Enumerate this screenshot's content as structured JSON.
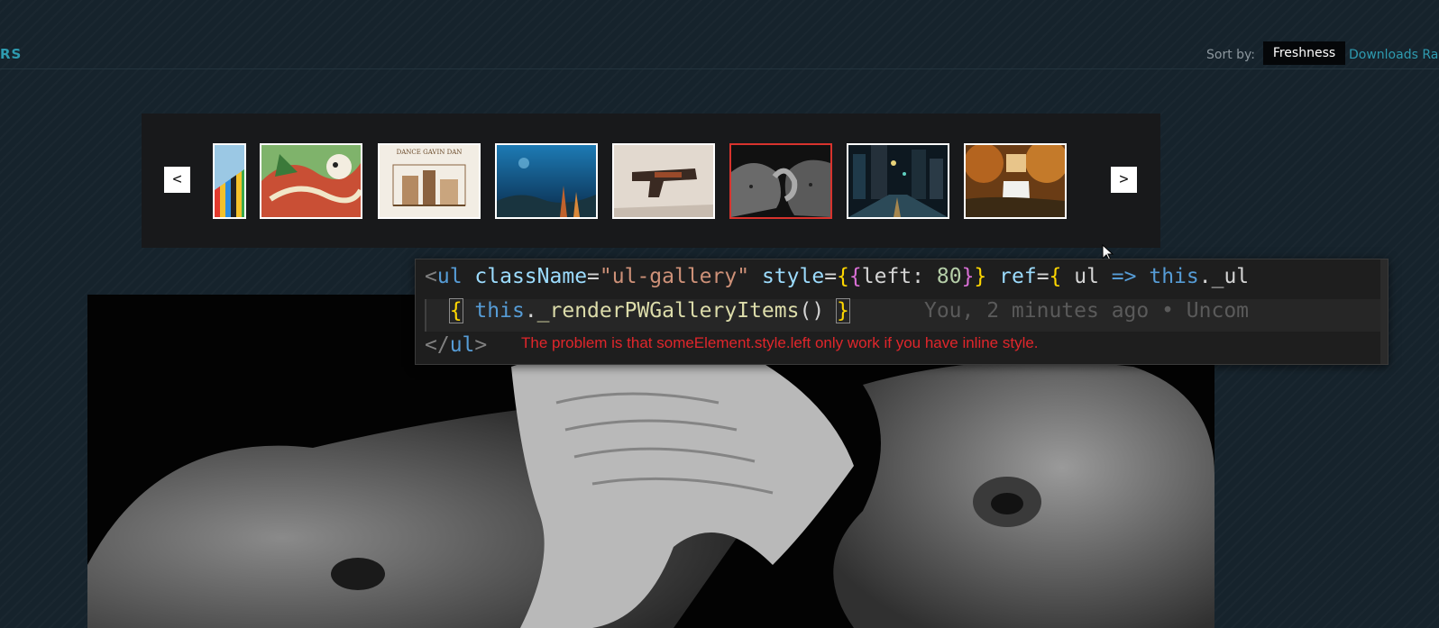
{
  "header": {
    "brand_fragment": "RS",
    "sort_label": "Sort by:",
    "sort_active": "Freshness",
    "sort_other": "Downloads Ra"
  },
  "gallery": {
    "prev_label": "<",
    "next_label": ">",
    "thumbnails": [
      {
        "name": "colorful-bars"
      },
      {
        "name": "cartoon-illustration"
      },
      {
        "name": "dance-gavin-dan-poster",
        "text": "DANCE GAVIN DAN"
      },
      {
        "name": "underwater-scene"
      },
      {
        "name": "pistol"
      },
      {
        "name": "elephants-bw",
        "selected": true
      },
      {
        "name": "city-night"
      },
      {
        "name": "waterfall-autumn"
      }
    ]
  },
  "editor": {
    "line1": {
      "open_tag": "<",
      "tag": "ul",
      "attr1": "className",
      "eq1": "=",
      "value1": "\"ul-gallery\"",
      "attr2": "style",
      "eq2": "=",
      "b1": "{",
      "b2": "{",
      "prop": "left: ",
      "num": "80",
      "b3": "}",
      "b4": "}",
      "attr3": "ref",
      "eq3": "=",
      "b5": "{",
      "param": " ul ",
      "arrow": "=>",
      "kw_this": "this",
      "rest": "._ul"
    },
    "line2": {
      "b1": "{",
      "kw_this": "this",
      "dot": ".",
      "fn": "_renderPWGalleryItems",
      "parens": "()",
      "b2": "}",
      "blame": "You, 2 minutes ago • Uncom"
    },
    "line3": {
      "close": "</",
      "tag": "ul",
      "end": ">"
    },
    "note": "The problem is that someElement.style.left only work if you have inline style."
  },
  "colors": {
    "accent": "#2e9bb0",
    "note_red": "#e0262b",
    "selected_border": "#d8332d"
  }
}
